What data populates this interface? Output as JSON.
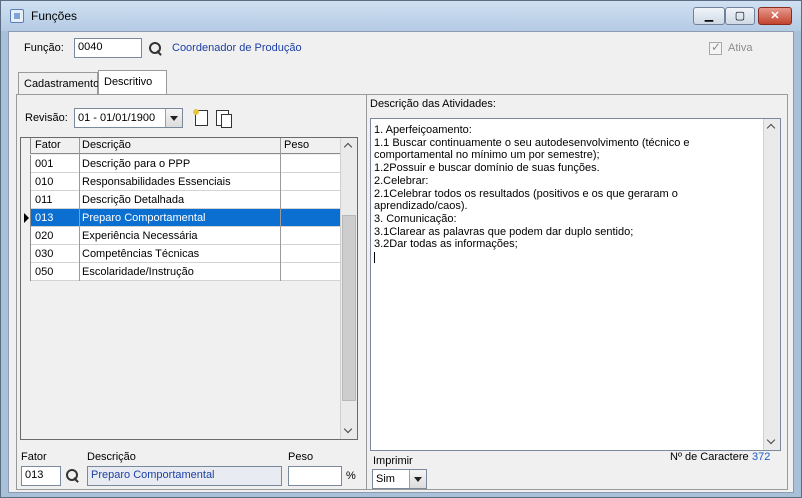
{
  "window": {
    "title": "Funções",
    "minimize_label": "▁",
    "maximize_label": "▢",
    "close_label": "✕"
  },
  "header": {
    "function_label": "Função:",
    "function_code": "0040",
    "function_name": "Coordenador de Produção",
    "active_label": "Ativa",
    "active_checked": true
  },
  "tabs": [
    {
      "label": "Cadastramento",
      "active": false
    },
    {
      "label": "Descritivo",
      "active": true
    }
  ],
  "revision": {
    "label": "Revisão:",
    "value": "01 - 01/01/1900"
  },
  "grid": {
    "columns": [
      "Fator",
      "Descrição",
      "Peso"
    ],
    "rows": [
      {
        "fator": "001",
        "descricao": "Descrição para o PPP",
        "peso": ""
      },
      {
        "fator": "010",
        "descricao": "Responsabilidades Essenciais",
        "peso": ""
      },
      {
        "fator": "011",
        "descricao": "Descrição Detalhada",
        "peso": ""
      },
      {
        "fator": "013",
        "descricao": "Preparo Comportamental",
        "peso": ""
      },
      {
        "fator": "020",
        "descricao": "Experiência Necessária",
        "peso": ""
      },
      {
        "fator": "030",
        "descricao": "Competências Técnicas",
        "peso": ""
      },
      {
        "fator": "050",
        "descricao": "Escolaridade/Instrução",
        "peso": ""
      }
    ],
    "selected_index": 3
  },
  "footer": {
    "fator_label": "Fator",
    "fator_value": "013",
    "descricao_label": "Descrição",
    "descricao_value": "Preparo Comportamental",
    "peso_label": "Peso",
    "peso_value": "",
    "percent": "%"
  },
  "description": {
    "title": "Descrição das Atividades:",
    "text": "1. Aperfeiçoamento:\n1.1 Buscar continuamente o seu autodesenvolvimento (técnico e comportamental no mínimo um por semestre);\n1.2Possuir e buscar domínio de suas funções.\n2.Celebrar:\n2.1Celebrar todos os resultados (positivos e os que geraram o aprendizado/caos).\n3. Comunicação:\n3.1Clarear as palavras que podem dar duplo sentido;\n3.2Dar todas as informações;",
    "imprimir_label": "Imprimir",
    "imprimir_value": "Sim",
    "char_count_label": "Nº de Caractere",
    "char_count_value": "372"
  }
}
